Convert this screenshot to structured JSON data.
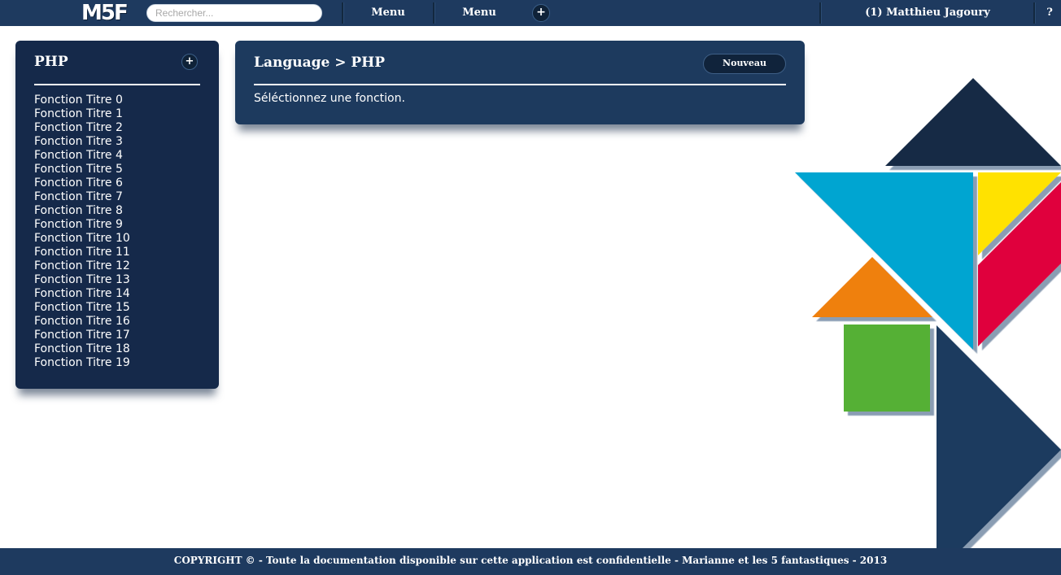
{
  "topbar": {
    "logo": "M5F",
    "search_placeholder": "Rechercher...",
    "menu1": "Menu",
    "menu2": "Menu",
    "add_label": "+",
    "user": "(1) Matthieu Jagoury",
    "help": "?"
  },
  "sidebar": {
    "title": "PHP",
    "add_label": "+",
    "items": [
      "Fonction Titre 0",
      "Fonction Titre 1",
      "Fonction Titre 2",
      "Fonction Titre 3",
      "Fonction Titre 4",
      "Fonction Titre 5",
      "Fonction Titre 6",
      "Fonction Titre 7",
      "Fonction Titre 8",
      "Fonction Titre 9",
      "Fonction Titre 10",
      "Fonction Titre 11",
      "Fonction Titre 12",
      "Fonction Titre 13",
      "Fonction Titre 14",
      "Fonction Titre 15",
      "Fonction Titre 16",
      "Fonction Titre 17",
      "Fonction Titre 18",
      "Fonction Titre 19"
    ]
  },
  "main": {
    "breadcrumb": "Language > PHP",
    "new_button": "Nouveau",
    "message": "Séléctionnez une fonction."
  },
  "footer": {
    "text": "COPYRIGHT © - Toute la documentation disponible sur cette application est confidentielle - Marianne et les 5 fantastiques - 2013"
  },
  "colors": {
    "navy": "#1e3a5f",
    "dark_navy": "#142a48",
    "blue": "#00a5d1",
    "yellow": "#ffe200",
    "red": "#e0003c",
    "orange": "#ef8011",
    "green": "#55b035"
  }
}
